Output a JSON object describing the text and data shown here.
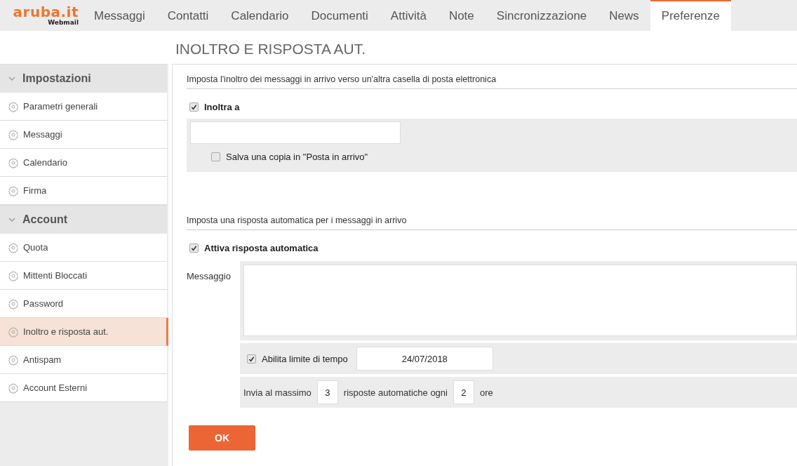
{
  "logo": {
    "name": "aruba.it",
    "subtitle": "Webmail"
  },
  "tabs": [
    {
      "label": "Messaggi",
      "selected": false
    },
    {
      "label": "Contatti",
      "selected": false
    },
    {
      "label": "Calendario",
      "selected": false
    },
    {
      "label": "Documenti",
      "selected": false
    },
    {
      "label": "Attività",
      "selected": false
    },
    {
      "label": "Note",
      "selected": false
    },
    {
      "label": "Sincronizzazione",
      "selected": false
    },
    {
      "label": "News",
      "selected": false
    },
    {
      "label": "Preferenze",
      "selected": true
    }
  ],
  "page_title": "INOLTRO E RISPOSTA AUT.",
  "sidebar": {
    "groups": [
      {
        "title": "Impostazioni",
        "expanded": true,
        "items": [
          {
            "label": "Parametri generali",
            "selected": false
          },
          {
            "label": "Messaggi",
            "selected": false
          },
          {
            "label": "Calendario",
            "selected": false
          },
          {
            "label": "Firma",
            "selected": false
          }
        ]
      },
      {
        "title": "Account",
        "expanded": true,
        "items": [
          {
            "label": "Quota",
            "selected": false
          },
          {
            "label": "Mittenti Bloccati",
            "selected": false
          },
          {
            "label": "Password",
            "selected": false
          },
          {
            "label": "Inoltro e risposta aut.",
            "selected": true
          },
          {
            "label": "Antispam",
            "selected": false
          },
          {
            "label": "Account Esterni",
            "selected": false
          }
        ]
      }
    ]
  },
  "forwarding": {
    "heading": "Imposta l'inoltro dei messaggi in arrivo verso un'altra casella di posta elettronica",
    "enabled": {
      "label": "Inoltra a",
      "checked": true
    },
    "save_copy": {
      "label": "Salva una copia in \"Posta in arrivo\"",
      "checked": false
    }
  },
  "autoreply": {
    "heading": "Imposta una risposta automatica per i messaggi in arrivo",
    "enabled": {
      "label": "Attiva risposta automatica",
      "checked": true
    },
    "message_label": "Messaggio",
    "time_limit": {
      "label": "Abilita limite di tempo",
      "checked": true,
      "date": "24/07/2018"
    },
    "limit": {
      "prefix": "Invia al massimo",
      "max_value": "3",
      "middle": "risposte automatiche ogni",
      "hours_value": "2",
      "suffix": "ore"
    }
  },
  "ok_button": "OK"
}
